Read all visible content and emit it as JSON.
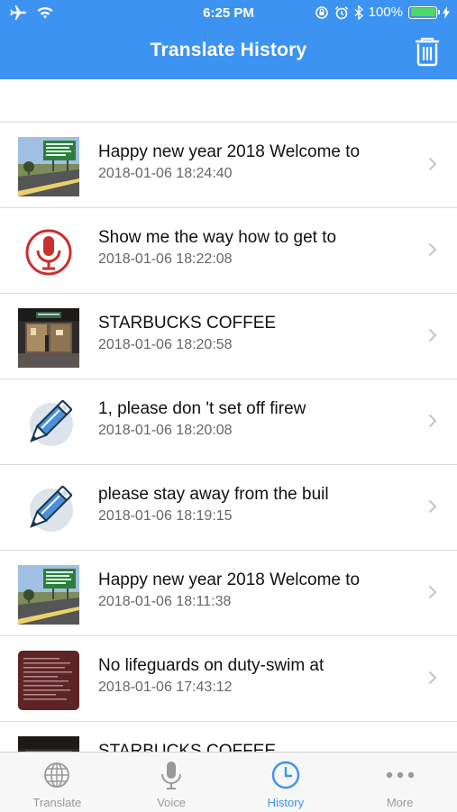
{
  "status_bar": {
    "time": "6:25 PM",
    "battery": "100%",
    "battery_level": 1.0,
    "icons": [
      "airplane-icon",
      "wifi-icon",
      "rotation-lock-icon",
      "alarm-icon",
      "bluetooth-icon",
      "battery-icon",
      "charging-icon"
    ]
  },
  "nav": {
    "title": "Translate History",
    "right_icon": "trash-icon"
  },
  "colors": {
    "accent": "#3d93f2",
    "tab_inactive": "#999999",
    "row_title": "#111111",
    "row_time": "#666666"
  },
  "history": [
    {
      "title": "Happy new year 2018 Welcome to",
      "time": "2018-01-06 18:24:40",
      "thumb": "photo-road"
    },
    {
      "title": "Show me the way how to get to",
      "time": "2018-01-06 18:22:08",
      "thumb": "microphone-icon"
    },
    {
      "title": "STARBUCKS COFFEE",
      "time": "2018-01-06 18:20:58",
      "thumb": "photo-store"
    },
    {
      "title": "1, please don 't set off firew",
      "time": "2018-01-06 18:20:08",
      "thumb": "pencil-icon"
    },
    {
      "title": "please stay away from the buil",
      "time": "2018-01-06 18:19:15",
      "thumb": "pencil-icon"
    },
    {
      "title": "Happy new year 2018 Welcome to",
      "time": "2018-01-06 18:11:38",
      "thumb": "photo-road"
    },
    {
      "title": "No lifeguards on duty-swim at",
      "time": "2018-01-06 17:43:12",
      "thumb": "photo-sign"
    },
    {
      "title": "STARBUCKS COFFEE",
      "time": "",
      "thumb": "photo-store"
    }
  ],
  "tabs": [
    {
      "label": "Translate",
      "icon": "globe-icon",
      "active": false
    },
    {
      "label": "Voice",
      "icon": "microphone-icon",
      "active": false
    },
    {
      "label": "History",
      "icon": "clock-icon",
      "active": true
    },
    {
      "label": "More",
      "icon": "more-icon",
      "active": false
    }
  ]
}
